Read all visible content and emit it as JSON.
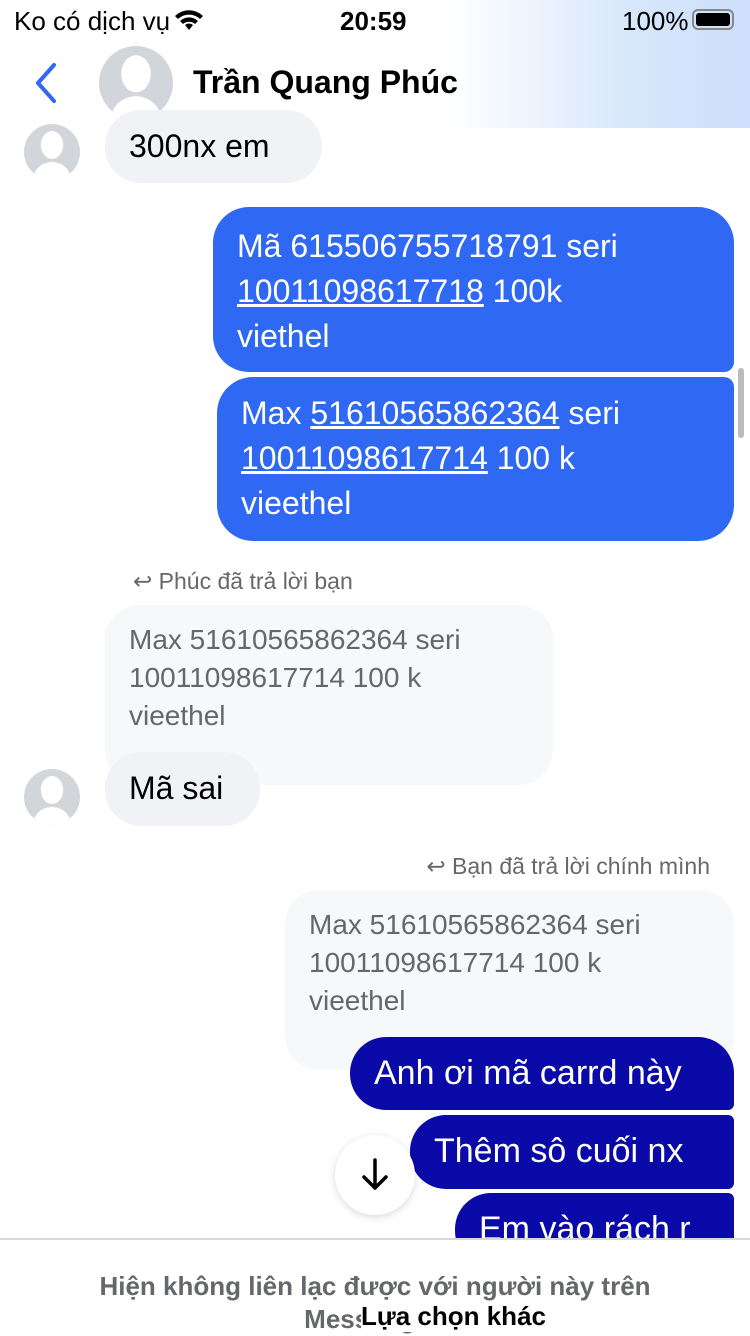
{
  "status_bar": {
    "carrier": "Ko có dịch vụ",
    "time": "20:59",
    "battery": "100%"
  },
  "header": {
    "contact_name": "Trần Quang Phúc"
  },
  "messages": [
    {
      "sender": "them",
      "text": "300nx em"
    },
    {
      "sender": "me",
      "lines": [
        "Mã 615506755718791 seri",
        "10011098617718",
        " 100k",
        "viethel"
      ]
    },
    {
      "sender": "me",
      "parts": [
        "Max ",
        "51610565862364",
        " seri",
        "10011098617714",
        " 100 k",
        "vieethel"
      ]
    },
    {
      "sender": "them",
      "reply_label": "Phúc đã trả lời bạn",
      "quoted": [
        "Max 51610565862364 seri",
        "10011098617714 100 k",
        "vieethel"
      ],
      "text": "Mã sai"
    },
    {
      "sender": "me",
      "reply_label": "Bạn đã trả lời chính mình",
      "quoted": [
        "Max 51610565862364 seri",
        "10011098617714 100 k",
        "vieethel"
      ]
    },
    {
      "sender": "me",
      "text": "Anh ơi mã carrd này"
    },
    {
      "sender": "me",
      "text": "Thêm sô cuối nx"
    },
    {
      "sender": "me",
      "text": "Em vào rách r"
    }
  ],
  "footer": {
    "text": "Hiện không liên lạc được với người này trên Messenger.",
    "link": "Lựa chọn khác"
  },
  "colors": {
    "accent": "#2f68f2",
    "dark_bubble": "#0a0aa8"
  }
}
